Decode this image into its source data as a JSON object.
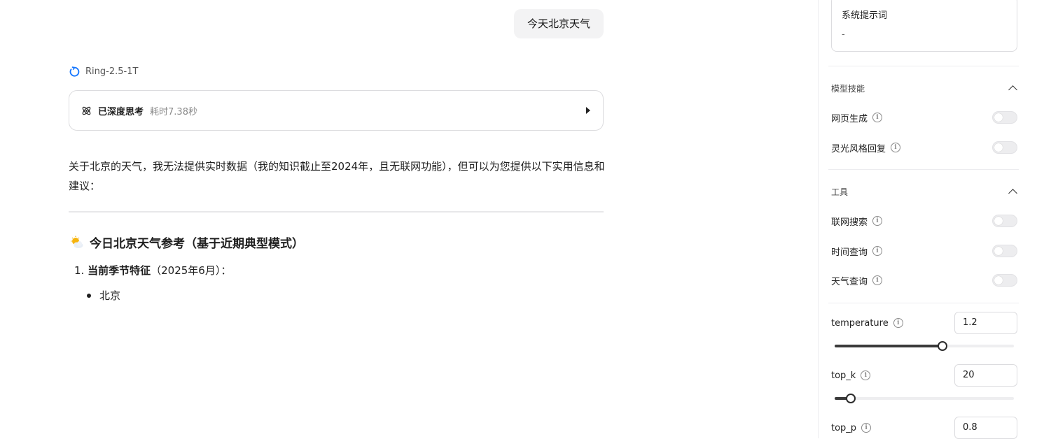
{
  "chat": {
    "user_message": "今天北京天气",
    "model_name": "Ring-2.5-1T",
    "thinking": {
      "title": "已深度思考",
      "duration": "耗时7.38秒"
    },
    "answer_paragraph": "关于北京的天气，我无法提供实时数据（我的知识截止至2024年，且无联网功能），但可以为您提供以下实用信息和建议：",
    "section_title": "今日北京天气参考（基于近期典型模式）",
    "ordered_item": {
      "number": "1.",
      "bold": "当前季节特征",
      "rest": "（2025年6月）："
    },
    "bullet": "北京"
  },
  "panel": {
    "system_prompt": {
      "label": "系统提示词",
      "value": "-"
    },
    "skills": {
      "title": "模型技能",
      "items": [
        {
          "label": "网页生成",
          "enabled": false
        },
        {
          "label": "灵光风格回复",
          "enabled": false
        }
      ]
    },
    "tools": {
      "title": "工具",
      "items": [
        {
          "label": "联网搜索",
          "enabled": false
        },
        {
          "label": "时间查询",
          "enabled": false
        },
        {
          "label": "天气查询",
          "enabled": false
        }
      ]
    },
    "params": {
      "temperature": {
        "label": "temperature",
        "value": "1.2",
        "slider_fraction": 0.6
      },
      "top_k": {
        "label": "top_k",
        "value": "20",
        "slider_fraction": 0.09
      },
      "top_p": {
        "label": "top_p",
        "value": "0.8"
      }
    }
  },
  "icons": {
    "model_logo": "ring-logo-icon",
    "thinking": "atom-icon",
    "expand": "caret-right-icon",
    "weather": "sun-behind-cloud-icon",
    "info": "info-icon",
    "collapse": "chevron-up-icon"
  },
  "colors": {
    "logo_blue": "#1677ff",
    "slider_dark": "#3a3a3a"
  }
}
